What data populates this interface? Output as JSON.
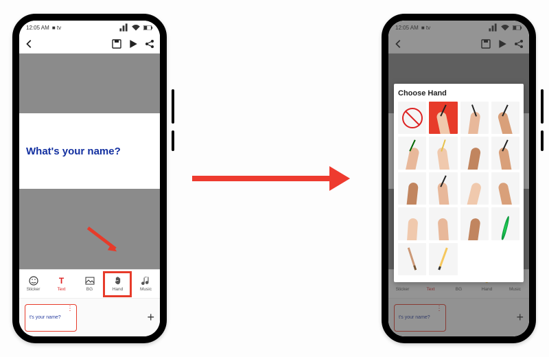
{
  "status": {
    "time": "12:05 AM",
    "rec_indicator": "■ tv"
  },
  "canvas": {
    "text": "What's your name?"
  },
  "toolbar": {
    "items": [
      {
        "id": "sticker",
        "label": "Sticker"
      },
      {
        "id": "text",
        "label": "Text"
      },
      {
        "id": "bg",
        "label": "BG"
      },
      {
        "id": "hand",
        "label": "Hand"
      },
      {
        "id": "music",
        "label": "Music"
      }
    ]
  },
  "thumb": {
    "caption": "t's your name?"
  },
  "dialog": {
    "title": "Choose Hand",
    "cells": [
      "none",
      "hand-red",
      "hand-1",
      "hand-2",
      "hand-3",
      "hand-4",
      "hand-5",
      "hand-6",
      "hand-7",
      "hand-8",
      "hand-9",
      "hand-10",
      "hand-11",
      "hand-12",
      "hand-13",
      "feather",
      "brush",
      "pencil",
      "empty",
      "empty"
    ]
  }
}
